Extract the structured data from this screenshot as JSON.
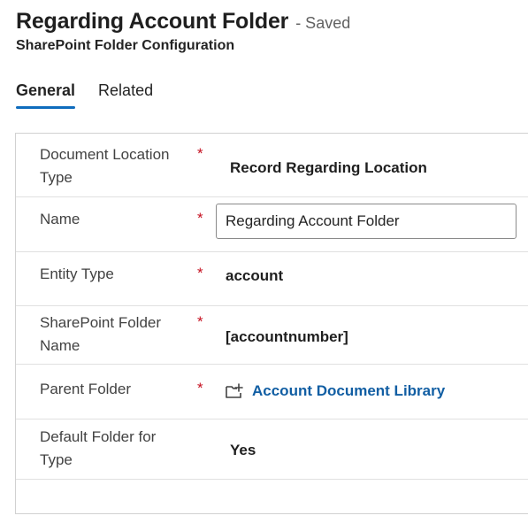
{
  "header": {
    "title": "Regarding Account Folder",
    "save_status": "- Saved",
    "subtitle": "SharePoint Folder Configuration"
  },
  "tabs": [
    {
      "label": "General",
      "active": true
    },
    {
      "label": "Related",
      "active": false
    }
  ],
  "form": {
    "required_marker": "*",
    "fields": {
      "document_location_type": {
        "label": "Document Location Type",
        "value": "Record Regarding Location"
      },
      "name": {
        "label": "Name",
        "value": "Regarding Account Folder"
      },
      "entity_type": {
        "label": "Entity Type",
        "value": "account"
      },
      "sharepoint_folder_name": {
        "label": "SharePoint Folder Name",
        "value": "[accountnumber]"
      },
      "parent_folder": {
        "label": "Parent Folder",
        "value": "Account Document Library",
        "icon": "folder-plus-icon"
      },
      "default_folder_for_type": {
        "label": "Default Folder for Type",
        "value": "Yes"
      }
    }
  },
  "colors": {
    "accent": "#0f6cbd",
    "link": "#115ea3",
    "required": "#c50f1f",
    "border": "#d1d1d1"
  }
}
